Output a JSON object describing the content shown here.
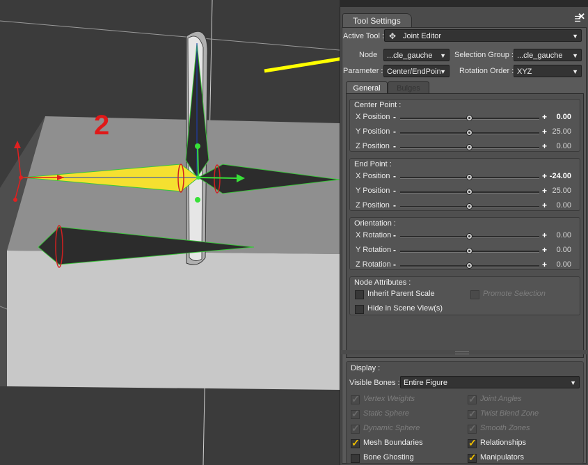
{
  "viewport": {
    "step_number": "2"
  },
  "panel": {
    "tab_title": "Tool Settings",
    "close_glyph": "✕",
    "menu_icon": "menu-icon",
    "active_tool": {
      "label": "Active Tool :",
      "value": "Joint Editor",
      "icon": "joint-editor-icon"
    },
    "node": {
      "label": "Node",
      "value": "...cle_gauche"
    },
    "selection_group": {
      "label": "Selection Group :",
      "value": "...cle_gauche"
    },
    "parameter": {
      "label": "Parameter :",
      "value": "Center/EndPoin"
    },
    "rotation_order": {
      "label": "Rotation Order :",
      "value": "XYZ"
    },
    "tabs": [
      {
        "label": "General"
      },
      {
        "label": "Bulges"
      }
    ],
    "center_point": {
      "title": "Center Point :",
      "rows": [
        {
          "label": "X Position",
          "value": "0.00",
          "bold": true,
          "level": 0.5
        },
        {
          "label": "Y Position",
          "value": "25.00",
          "bold": false,
          "level": 0.5
        },
        {
          "label": "Z Position",
          "value": "0.00",
          "bold": false,
          "level": 0.5
        }
      ]
    },
    "end_point": {
      "title": "End Point :",
      "rows": [
        {
          "label": "X Position",
          "value": "-24.00",
          "bold": true,
          "level": 0.5
        },
        {
          "label": "Y Position",
          "value": "25.00",
          "bold": false,
          "level": 0.5
        },
        {
          "label": "Z Position",
          "value": "0.00",
          "bold": false,
          "level": 0.5
        }
      ]
    },
    "orientation": {
      "title": "Orientation :",
      "rows": [
        {
          "label": "X Rotation",
          "value": "0.00",
          "bold": false,
          "level": 0.5
        },
        {
          "label": "Y Rotation",
          "value": "0.00",
          "bold": false,
          "level": 0.5
        },
        {
          "label": "Z Rotation",
          "value": "0.00",
          "bold": false,
          "level": 0.5
        }
      ]
    },
    "node_attributes": {
      "title": "Node Attributes :",
      "inherit_parent_scale": "Inherit Parent Scale",
      "promote_selection": "Promote Selection",
      "hide_in_scene": "Hide in Scene View(s)"
    },
    "display": {
      "title": "Display :",
      "visible_bones_label": "Visible Bones :",
      "visible_bones_value": "Entire Figure",
      "options_left": [
        {
          "label": "Vertex Weights",
          "checked": true,
          "disabled": true
        },
        {
          "label": "Static Sphere",
          "checked": true,
          "disabled": true
        },
        {
          "label": "Dynamic Sphere",
          "checked": true,
          "disabled": true
        },
        {
          "label": "Mesh Boundaries",
          "checked": true,
          "disabled": false
        },
        {
          "label": "Bone Ghosting",
          "checked": false,
          "disabled": false
        }
      ],
      "options_right": [
        {
          "label": "Joint Angles",
          "checked": true,
          "disabled": true
        },
        {
          "label": "Twist Blend Zone",
          "checked": true,
          "disabled": true
        },
        {
          "label": "Smooth Zones",
          "checked": true,
          "disabled": true
        },
        {
          "label": "Relationships",
          "checked": true,
          "disabled": false
        },
        {
          "label": "Manipulators",
          "checked": true,
          "disabled": false
        }
      ]
    }
  },
  "colors": {
    "annotation_arrow": "#ffff00",
    "step_number": "#e01818",
    "selected_bone": "#f5e030",
    "check": "#f0c000"
  }
}
